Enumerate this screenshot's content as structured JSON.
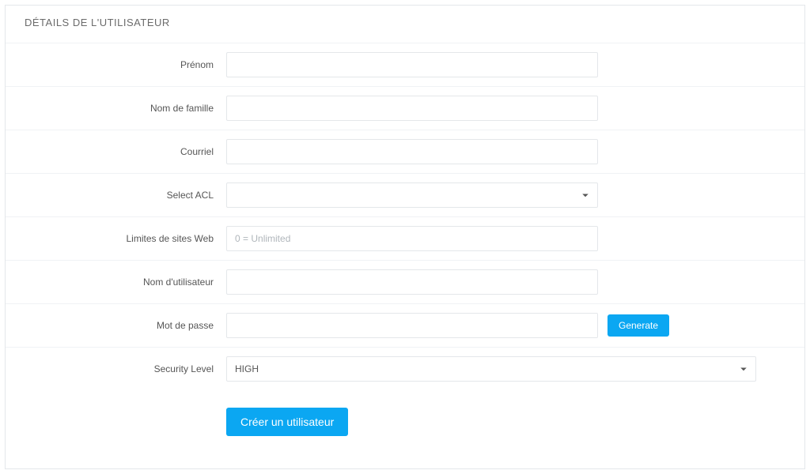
{
  "panel": {
    "heading": "DÉTAILS DE L'UTILISATEUR"
  },
  "fields": {
    "firstName": {
      "label": "Prénom",
      "value": ""
    },
    "lastName": {
      "label": "Nom de famille",
      "value": ""
    },
    "email": {
      "label": "Courriel",
      "value": ""
    },
    "selectAcl": {
      "label": "Select ACL",
      "value": "",
      "options": [
        ""
      ]
    },
    "websiteLimits": {
      "label": "Limites de sites Web",
      "value": "",
      "placeholder": "0 = Unlimited"
    },
    "username": {
      "label": "Nom d'utilisateur",
      "value": ""
    },
    "password": {
      "label": "Mot de passe",
      "value": ""
    },
    "securityLevel": {
      "label": "Security Level",
      "value": "HIGH",
      "options": [
        "HIGH"
      ]
    }
  },
  "buttons": {
    "generate": "Generate",
    "submit": "Créer un utilisateur"
  }
}
